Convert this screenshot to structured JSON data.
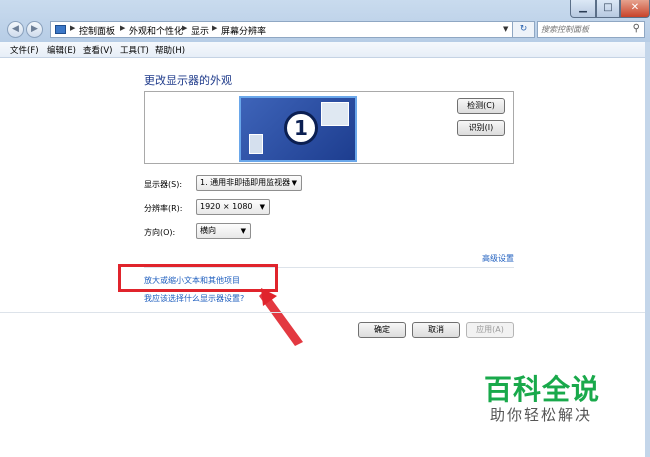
{
  "titlebar": {
    "controls": {
      "minimize": "▁",
      "maximize": "□",
      "close": "✕"
    },
    "back_glyph": "◀",
    "forward_glyph": "▶",
    "breadcrumbs": [
      "控制面板",
      "外观和个性化",
      "显示",
      "屏幕分辨率"
    ],
    "search_placeholder": "搜索控制面板",
    "refresh_glyph": "↻"
  },
  "menu": [
    "文件(F)",
    "编辑(E)",
    "查看(V)",
    "工具(T)",
    "帮助(H)"
  ],
  "main": {
    "heading": "更改显示器的外观",
    "monitor_number": "1",
    "detect_button": "检测(C)",
    "identify_button": "识别(I)",
    "display_label": "显示器(S):",
    "display_value": "1. 通用非即插即用监视器",
    "resolution_label": "分辨率(R):",
    "resolution_value": "1920 × 1080",
    "orientation_label": "方向(O):",
    "orientation_value": "横向",
    "advanced_link": "高级设置",
    "enlarge_link": "放大或缩小文本和其他项目",
    "which_settings_link": "我应该选择什么显示器设置?",
    "ok_button": "确定",
    "cancel_button": "取消",
    "apply_button": "应用(A)"
  },
  "watermark": {
    "title": "百科全说",
    "subtitle": "助你轻松解决"
  },
  "colors": {
    "annotation_red": "#e0242c",
    "watermark_green": "#19a94b",
    "link_blue": "#1f5fbf"
  }
}
